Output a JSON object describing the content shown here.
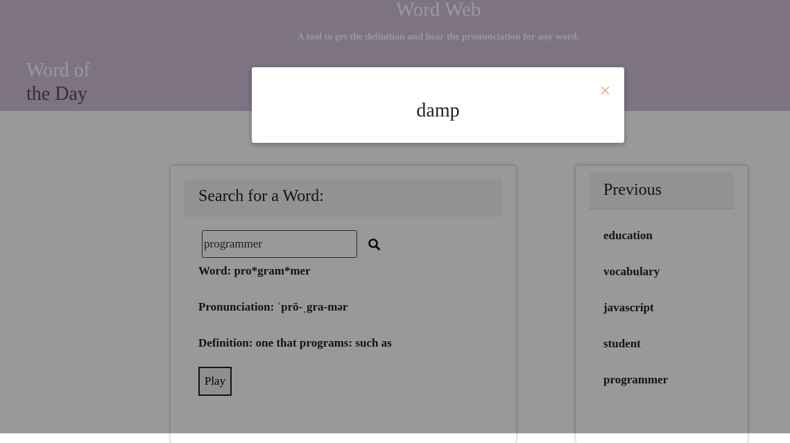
{
  "header": {
    "title": "Word Web",
    "tagline": "A tool to get the definition and hear the pronunciation for any word.",
    "word_of_day_line1": "Word of",
    "word_of_day_line2": "the Day"
  },
  "search": {
    "heading": "Search for a Word:",
    "input_value": "programmer",
    "icon": "search-icon",
    "word_line": "Word: pro*gram*mer",
    "pronunciation_line": "Pronunciation: ˈprō-ˌgra-mər",
    "definition_line": "Definition: one that programs: such as",
    "play_label": "Play"
  },
  "previous": {
    "heading": "Previous",
    "items": [
      "education",
      "vocabulary",
      "javascript",
      "student",
      "programmer"
    ]
  },
  "modal": {
    "word": "damp",
    "close_icon": "close-icon"
  },
  "colors": {
    "header_bg": "#d2c0da",
    "accent_dark": "#5a4966",
    "close_icon": "#f0a89a"
  }
}
